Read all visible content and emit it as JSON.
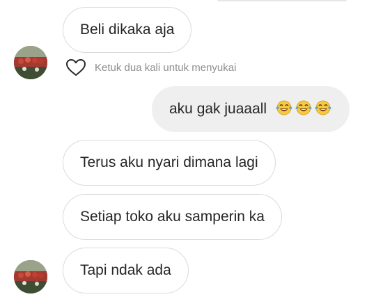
{
  "messages": [
    {
      "id": "m1",
      "direction": "incoming",
      "text": "Beli dikaka aja"
    },
    {
      "id": "m2",
      "direction": "outgoing",
      "text": "aku gak juaaall",
      "emoji": [
        "face-with-tears-of-joy",
        "face-with-tears-of-joy",
        "face-with-tears-of-joy"
      ]
    },
    {
      "id": "m3",
      "direction": "incoming",
      "text": "Terus aku nyari dimana lagi"
    },
    {
      "id": "m4",
      "direction": "incoming",
      "text": "Setiap toko aku samperin ka"
    },
    {
      "id": "m5",
      "direction": "incoming",
      "text": "Tapi ndak ada"
    }
  ],
  "like_hint": "Ketuk dua kali untuk menyukai",
  "icons": {
    "like": "heart-outline-icon",
    "reaction": "face-with-tears-of-joy"
  },
  "colors": {
    "incoming_bubble": "#ffffff",
    "incoming_border": "#dbdbdb",
    "outgoing_bubble": "#efefef",
    "text": "#262626",
    "hint_text": "#8e8e8e"
  }
}
